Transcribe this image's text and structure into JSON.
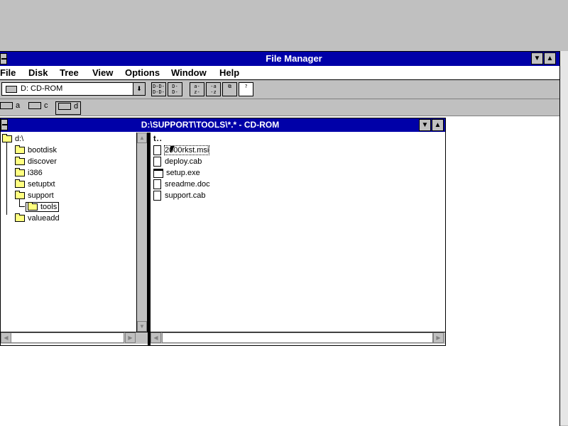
{
  "window": {
    "title": "File Manager",
    "minimize_glyph": "▼",
    "maximize_glyph": "▲"
  },
  "menu": {
    "file": "File",
    "disk": "Disk",
    "tree": "Tree",
    "view": "View",
    "options": "Options",
    "window": "Window",
    "help": "Help"
  },
  "toolbar": {
    "drive_combo_value": "D: CD-ROM",
    "drive_combo_arrow": "⬇",
    "buttons": [
      "D-D-\nD-D-",
      "D-\nD-",
      "a-\nz-",
      "-a\n-z",
      "⧉",
      "?"
    ]
  },
  "drives": {
    "a": "a",
    "c": "c",
    "d": "d"
  },
  "child_window": {
    "title": "D:\\SUPPORT\\TOOLS\\*.* - CD-ROM",
    "minimize_glyph": "▼",
    "maximize_glyph": "▲"
  },
  "tree": {
    "root": "d:\\",
    "items": [
      "bootdisk",
      "discover",
      "i386",
      "setuptxt",
      "support",
      "tools",
      "valueadd"
    ]
  },
  "files": {
    "updir": "t..",
    "items": [
      "2000rkst.msi",
      "deploy.cab",
      "setup.exe",
      "sreadme.doc",
      "support.cab"
    ]
  },
  "scroll": {
    "up": "▲",
    "down": "▼",
    "left": "◀",
    "right": "▶"
  }
}
